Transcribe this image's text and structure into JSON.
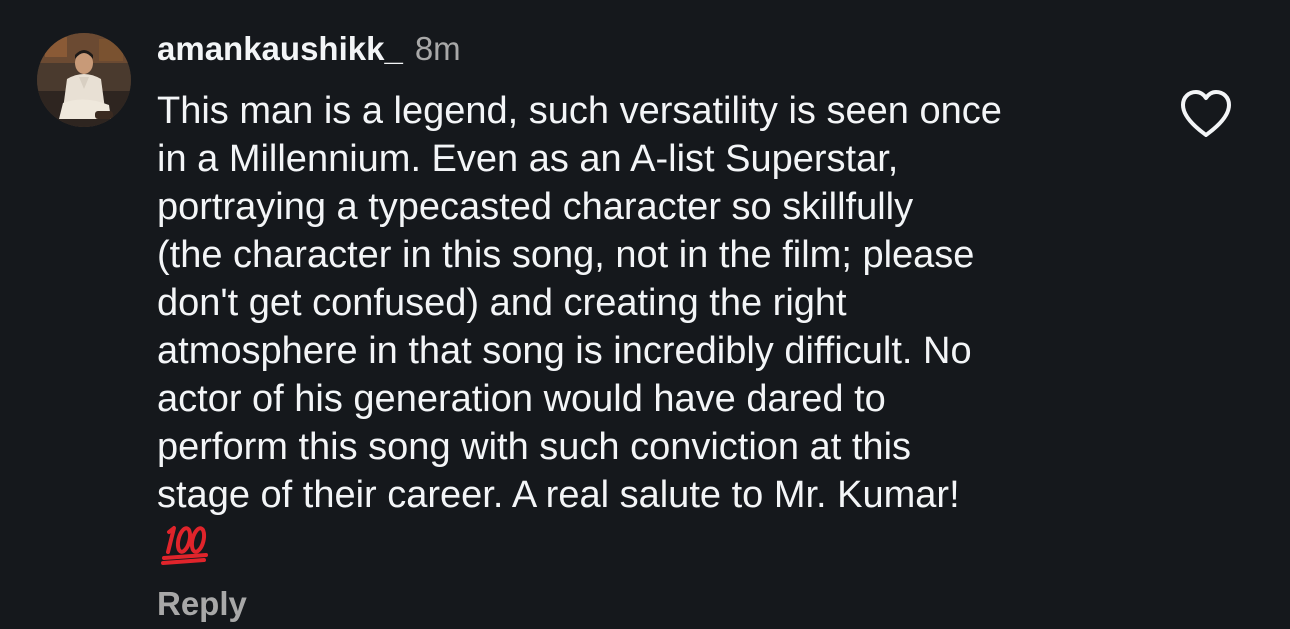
{
  "comment": {
    "username": "amankaushikk_",
    "timestamp": "8m",
    "text_lines": [
      "This man is a legend, such versatility is seen once",
      "in a Millennium. Even as an A-list Superstar,",
      "portraying a typecasted character so skillfully",
      "(the character in this song, not in the film; please",
      "don't get confused) and creating the right",
      "atmosphere in that song is incredibly difficult. No",
      "actor of his generation would have dared to",
      "perform this song with such conviction at this",
      "stage of their career. A real salute to Mr. Kumar!"
    ],
    "emoji": "100-emoji",
    "reply_label": "Reply",
    "like_icon": "heart-outline-icon"
  },
  "colors": {
    "background": "#15181c",
    "primary_text": "#f3f5f7",
    "secondary_text": "#a8a8a8",
    "emoji_red": "#e0242b"
  }
}
